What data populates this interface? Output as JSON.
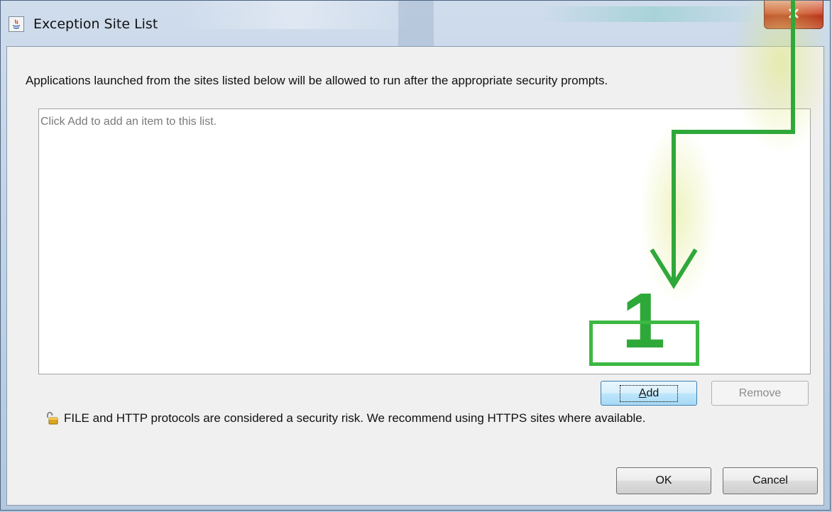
{
  "window": {
    "title": "Exception Site List",
    "close_label": "x"
  },
  "dialog": {
    "description": "Applications launched from the sites listed below will be allowed to run after the appropriate security prompts.",
    "list_placeholder": "Click Add to add an item to this list.",
    "add_button": {
      "prefix": "",
      "mnemonic": "A",
      "suffix": "dd"
    },
    "remove_button": "Remove",
    "warning": "FILE and HTTP protocols are considered a security risk.  We recommend using HTTPS sites where available.",
    "ok_button": "OK",
    "cancel_button": "Cancel"
  },
  "annotation": {
    "step_number": "1",
    "color": "#2fa83a"
  },
  "icons": {
    "app": "java-icon",
    "close": "close-icon",
    "warning": "unlocked-padlock-icon"
  }
}
